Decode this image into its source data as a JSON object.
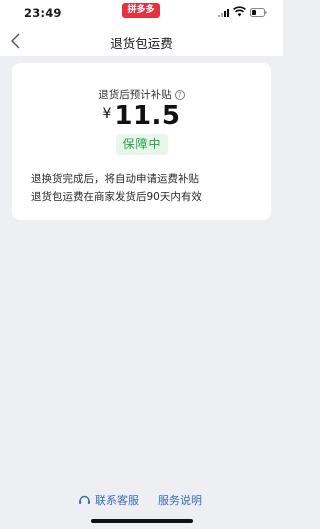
{
  "status_bar": {
    "time": "23:49",
    "app_badge": "拼多多"
  },
  "nav": {
    "title": "退货包运费"
  },
  "card": {
    "subsidy_label": "退货后预计补贴",
    "help_glyph": "?",
    "currency": "¥",
    "amount": "11.5",
    "status": "保障中",
    "desc_line1": "退换货完成后，将自动申请运费补贴",
    "desc_line2": "退货包运费在商家发货后90天内有效"
  },
  "footer": {
    "customer_service": "联系客服",
    "service_info": "服务说明"
  }
}
